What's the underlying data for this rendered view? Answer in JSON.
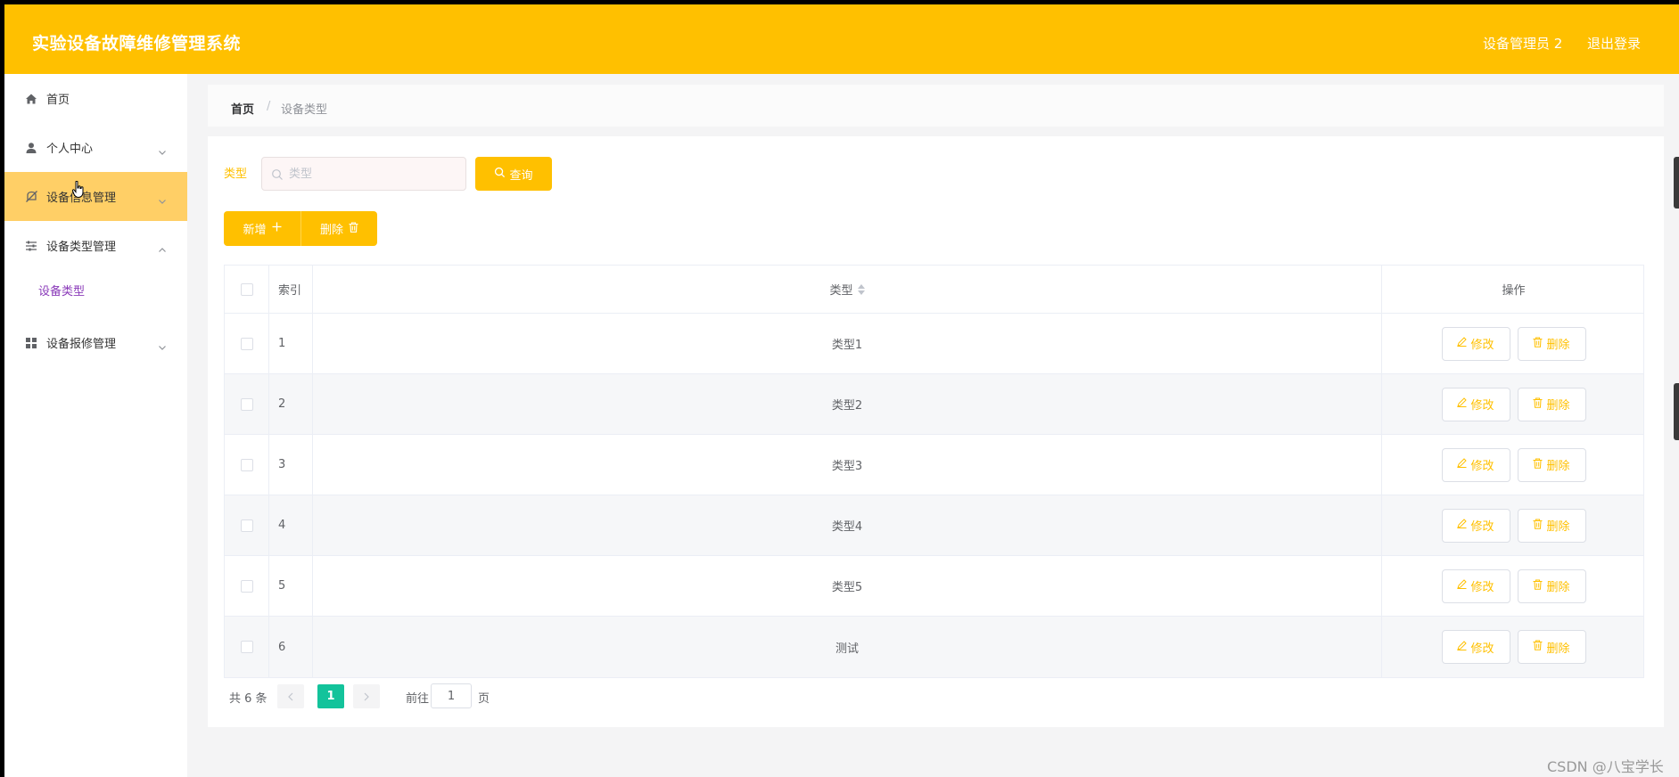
{
  "header": {
    "title": "实验设备故障维修管理系统",
    "user": "设备管理员 2",
    "logout": "退出登录",
    "background_color": "#ffc000"
  },
  "sidebar": {
    "items": [
      {
        "label": "首页",
        "icon": "home-icon",
        "expandable": false
      },
      {
        "label": "个人中心",
        "icon": "user-icon",
        "expandable": true,
        "expanded": false
      },
      {
        "label": "设备信息管理",
        "icon": "device-icon",
        "expandable": true,
        "expanded": false,
        "highlighted": true
      },
      {
        "label": "设备类型管理",
        "icon": "sliders-icon",
        "expandable": true,
        "expanded": true
      },
      {
        "label": "设备报修管理",
        "icon": "grid-icon",
        "expandable": true,
        "expanded": false
      }
    ],
    "submenu": [
      {
        "label": "设备类型",
        "parent": "设备类型管理"
      }
    ],
    "active_color": "#ffcf66"
  },
  "breadcrumb": {
    "home": "首页",
    "separator": "/",
    "current": "设备类型"
  },
  "search": {
    "label": "类型",
    "placeholder": "类型",
    "value": "",
    "button": "查询"
  },
  "toolbar": {
    "add": "新增",
    "delete": "删除"
  },
  "table": {
    "columns": [
      "索引",
      "类型",
      "操作"
    ],
    "rows": [
      {
        "index": "1",
        "type": "类型1"
      },
      {
        "index": "2",
        "type": "类型2"
      },
      {
        "index": "3",
        "type": "类型3"
      },
      {
        "index": "4",
        "type": "类型4"
      },
      {
        "index": "5",
        "type": "类型5"
      },
      {
        "index": "6",
        "type": "测试"
      }
    ],
    "row_actions": {
      "edit": "修改",
      "delete": "删除"
    }
  },
  "pagination": {
    "total": "共 6 条",
    "current_page": "1",
    "goto_label": "前往",
    "goto_value": "1",
    "goto_suffix": "页",
    "active_color": "#13c39b"
  },
  "watermark": "CSDN @八宝学长"
}
